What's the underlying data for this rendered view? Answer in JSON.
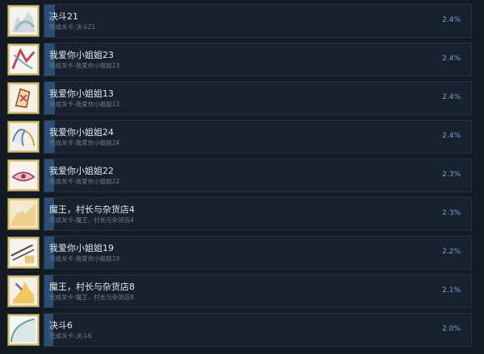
{
  "achievements": [
    {
      "title": "决斗21",
      "desc": "完成关卡-决斗21",
      "percent": "2.4%",
      "progress": 0.024
    },
    {
      "title": "我爱你小姐姐23",
      "desc": "完成关卡-我爱你小姐姐23",
      "percent": "2.4%",
      "progress": 0.024
    },
    {
      "title": "我爱你小姐姐13",
      "desc": "完成关卡-我爱你小姐姐13",
      "percent": "2.4%",
      "progress": 0.024
    },
    {
      "title": "我爱你小姐姐24",
      "desc": "完成关卡-我爱你小姐姐24",
      "percent": "2.4%",
      "progress": 0.024
    },
    {
      "title": "我爱你小姐姐22",
      "desc": "完成关卡-我爱你小姐姐22",
      "percent": "2.3%",
      "progress": 0.023
    },
    {
      "title": "魔王，村长与杂货店4",
      "desc": "完成关卡-魔王，村长与杂货店4",
      "percent": "2.3%",
      "progress": 0.023
    },
    {
      "title": "我爱你小姐姐19",
      "desc": "完成关卡-我爱你小姐姐19",
      "percent": "2.2%",
      "progress": 0.022
    },
    {
      "title": "魔王，村长与杂货店8",
      "desc": "完成关卡-魔王，村长与杂货店8",
      "percent": "2.1%",
      "progress": 0.021
    },
    {
      "title": "决斗6",
      "desc": "完成关卡-决斗6",
      "percent": "2.0%",
      "progress": 0.02
    }
  ]
}
